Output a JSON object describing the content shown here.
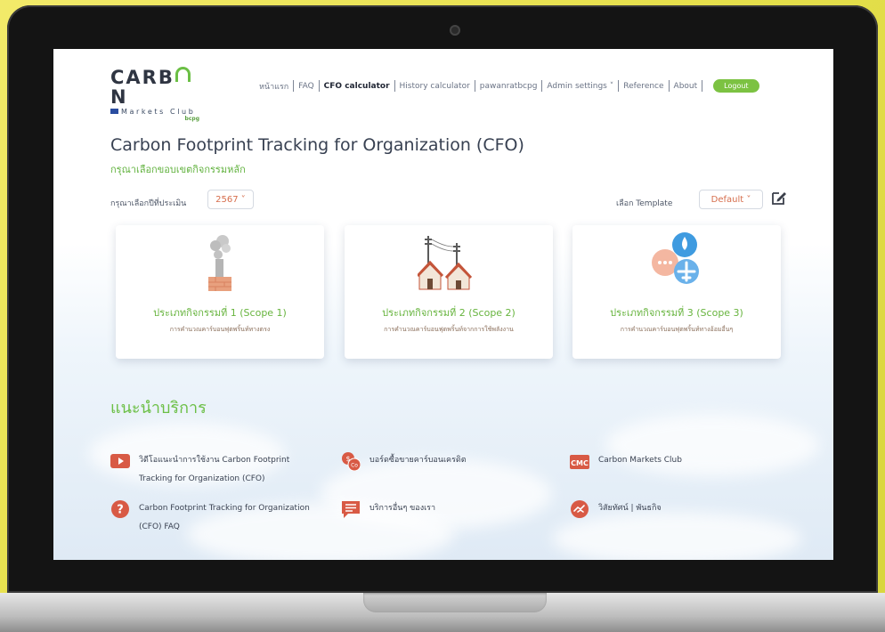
{
  "nav": {
    "items": [
      {
        "label": "หน้าแรก",
        "active": false
      },
      {
        "label": "FAQ",
        "active": false
      },
      {
        "label": "CFO calculator",
        "active": true
      },
      {
        "label": "History calculator",
        "active": false
      },
      {
        "label": "pawanratbcpg",
        "active": false
      },
      {
        "label": "Admin settings ˅",
        "active": false
      },
      {
        "label": "Reference",
        "active": false
      },
      {
        "label": "About",
        "active": false
      }
    ],
    "logout_label": "Logout"
  },
  "logo": {
    "main_before": "CARB",
    "main_after": "N",
    "sub": "Markets Club",
    "powered": "bcpg"
  },
  "page": {
    "title": "Carbon Footprint Tracking for Organization (CFO)",
    "subtitle": "กรุณาเลือกขอบเขตกิจกรรมหลัก"
  },
  "filters": {
    "year_label": "กรุณาเลือกปีที่ประเมิน",
    "year_value": "2567 ˅",
    "template_label": "เลือก Template",
    "template_value": "Default ˅"
  },
  "scopes": [
    {
      "title": "ประเภทกิจกรรมที่ 1 (Scope 1)",
      "desc": "การคำนวณคาร์บอนฟุตพริ้นท์ทางตรง",
      "icon": "factory-smoke-icon"
    },
    {
      "title": "ประเภทกิจกรรมที่ 2 (Scope 2)",
      "desc": "การคำนวณคาร์บอนฟุตพริ้นท์จากการใช้พลังงาน",
      "icon": "power-lines-houses-icon"
    },
    {
      "title": "ประเภทกิจกรรมที่ 3 (Scope 3)",
      "desc": "การคำนวณคาร์บอนฟุตพริ้นท์ทางอ้อมอื่นๆ",
      "icon": "water-plane-chat-icon"
    }
  ],
  "services": {
    "title": "แนะนำบริการ",
    "items": [
      {
        "label": "วิดีโอแนะนำการใช้งาน Carbon Footprint Tracking for Organization (CFO)",
        "icon": "video-play-icon"
      },
      {
        "label": "บอร์ดซื้อขายคาร์บอนเครดิต",
        "icon": "carbon-credit-icon"
      },
      {
        "label": "Carbon Markets Club",
        "icon": "cmc-logo-icon"
      },
      {
        "label": "Carbon Footprint Tracking for Organization (CFO) FAQ",
        "icon": "question-icon"
      },
      {
        "label": "บริการอื่นๆ ของเรา",
        "icon": "chat-lines-icon"
      },
      {
        "label": "วิสัยทัศน์ | พันธกิจ",
        "icon": "handshake-icon"
      }
    ],
    "cmc_text": "CMC",
    "co_text": "Co"
  },
  "colors": {
    "brand_green": "#6bbf45",
    "accent_orange": "#d66e4d",
    "text_dark": "#384152"
  }
}
